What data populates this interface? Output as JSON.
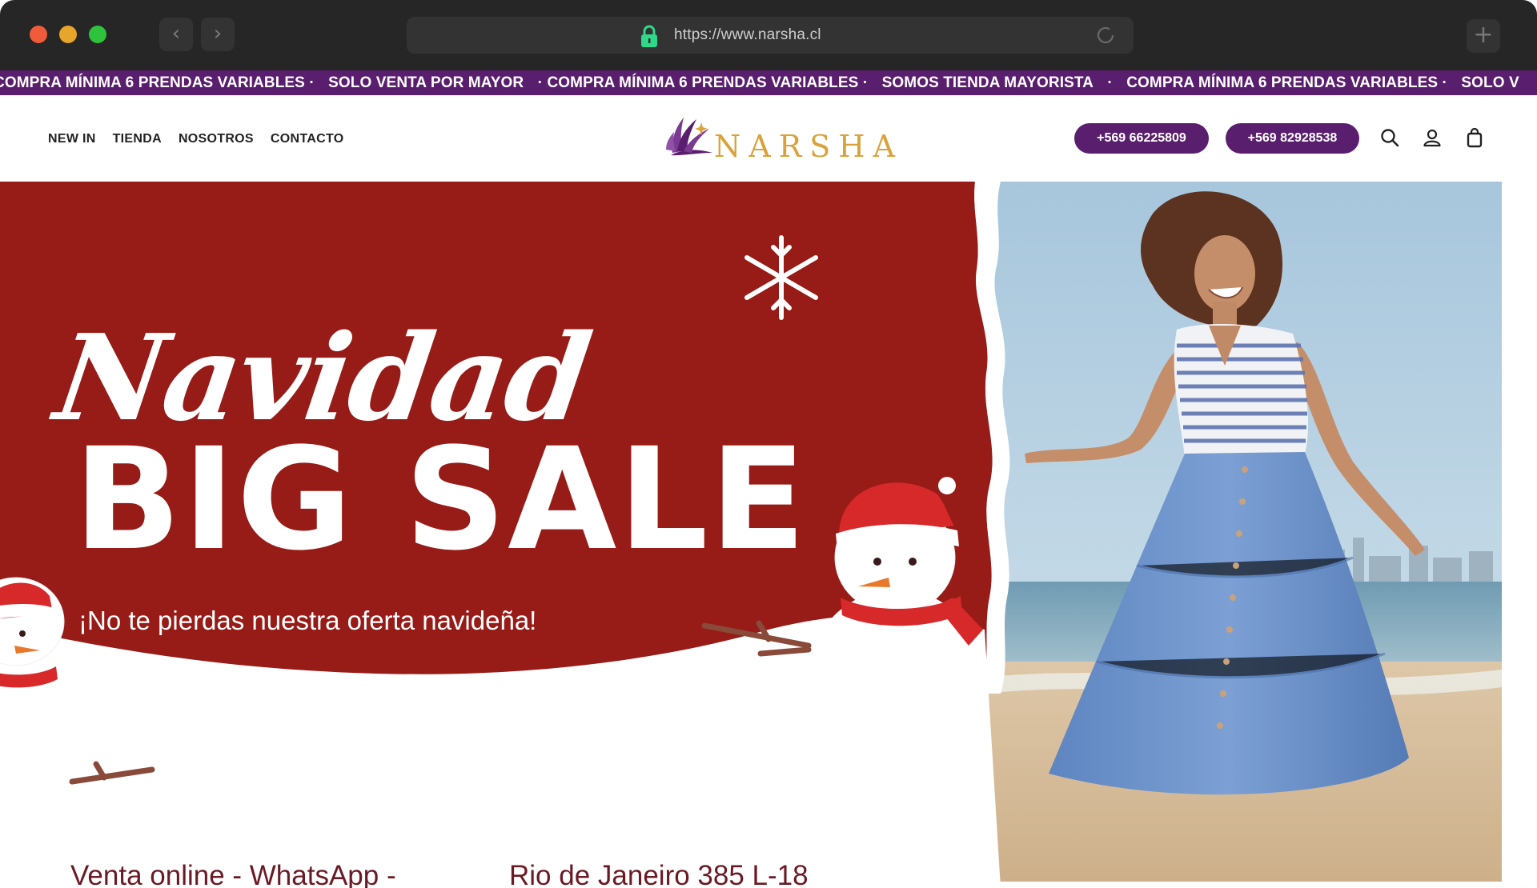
{
  "browser": {
    "url": "https://www.narsha.cl",
    "back_glyph": "‹",
    "forward_glyph": "›",
    "new_tab_glyph": "+"
  },
  "ticker": {
    "items": [
      "COMPRA MÍNIMA 6 PRENDAS VARIABLES ·",
      "SOLO VENTA POR MAYOR",
      "· COMPRA MÍNIMA 6 PRENDAS VARIABLES ·",
      "SOMOS TIENDA MAYORISTA",
      "·",
      "COMPRA MÍNIMA 6 PRENDAS VARIABLES ·",
      "SOLO V"
    ],
    "background": "#5a1e6e"
  },
  "header": {
    "menu": [
      "NEW IN",
      "TIENDA",
      "NOSOTROS",
      "CONTACTO"
    ],
    "logo_text": "NARSHA",
    "phones": [
      "+569 66225809",
      "+569 82928538"
    ],
    "icons": [
      "search-icon",
      "account-icon",
      "shopping-bag-icon"
    ]
  },
  "hero": {
    "script_title": "Navidad",
    "headline": "BIG SALE",
    "subtitle": "¡No te pierdas nuestra oferta navideña!",
    "info_left": "Venta online  - WhatsApp -",
    "info_right": "Rio de Janeiro 385 L-18",
    "red": "#971b16"
  },
  "colors": {
    "brand_purple": "#5a1e6e",
    "logo_gold": "#d9a23a",
    "chrome": "#262626"
  }
}
